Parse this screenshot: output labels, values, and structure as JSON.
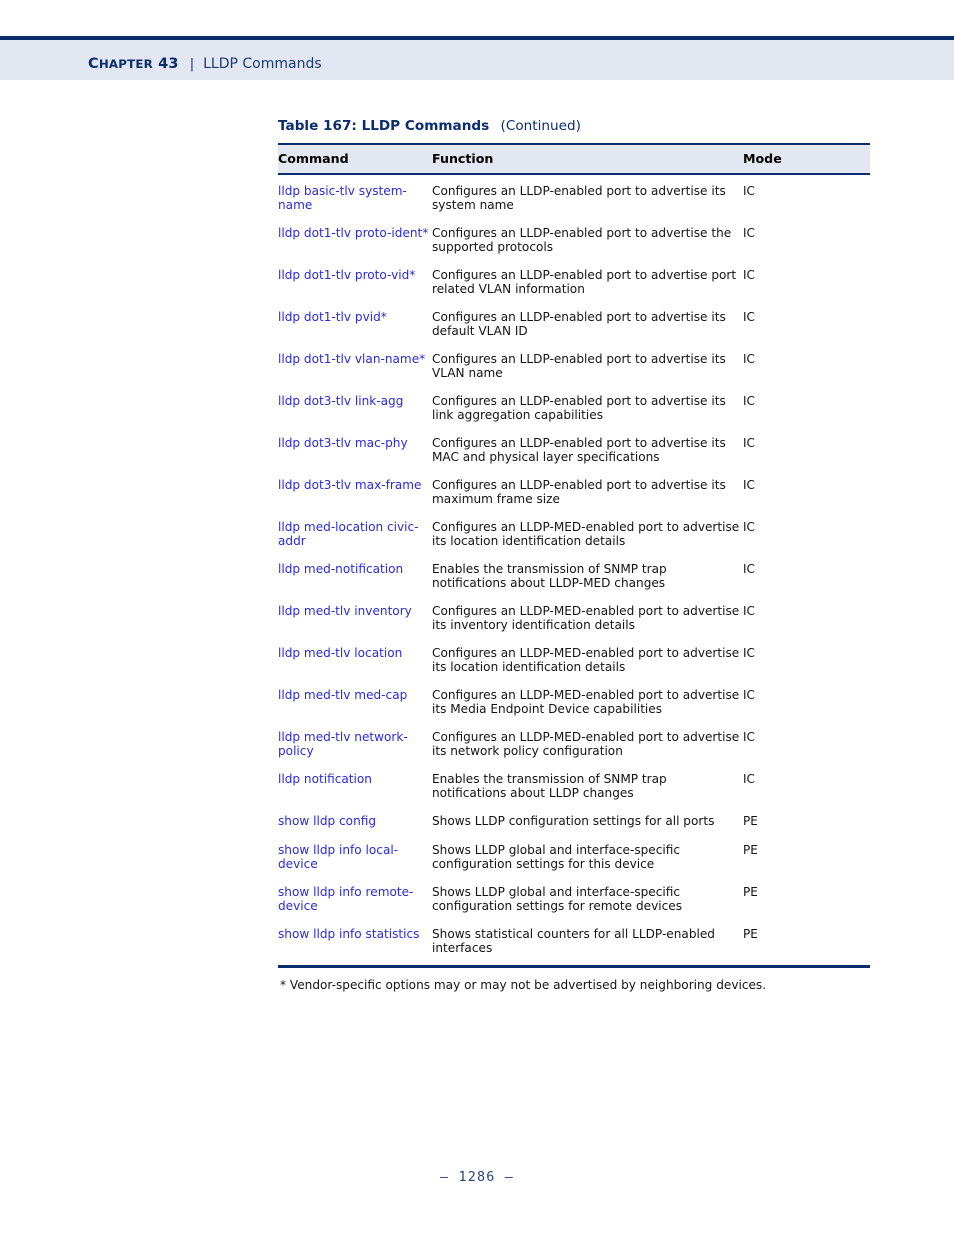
{
  "colors": {
    "navy": "#0a2d6e",
    "header_band_bg": "#e3e7f1",
    "link_blue": "#2a2ade",
    "body_text": "#141414",
    "footer_text": "#2a4478"
  },
  "header": {
    "chapter_prefix": "C",
    "chapter_word_rest": "HAPTER",
    "chapter_label": "Chapter 43",
    "chapter_number": "43",
    "separator": "|",
    "topic": "LLDP Commands"
  },
  "table": {
    "caption_main": "Table 167: LLDP Commands",
    "caption_continued": "(Continued)",
    "columns": [
      "Command",
      "Function",
      "Mode"
    ],
    "rows": [
      {
        "command": "lldp basic-tlv system-name",
        "function": "Configures an LLDP-enabled port to advertise its system name",
        "mode": "IC"
      },
      {
        "command": "lldp dot1-tlv proto-ident*",
        "function": "Configures an LLDP-enabled port to advertise the supported protocols",
        "mode": "IC"
      },
      {
        "command": "lldp dot1-tlv proto-vid*",
        "function": "Configures an LLDP-enabled port to advertise port related VLAN information",
        "mode": "IC"
      },
      {
        "command": "lldp dot1-tlv pvid*",
        "function": "Configures an LLDP-enabled port to advertise its default VLAN ID",
        "mode": "IC"
      },
      {
        "command": "lldp dot1-tlv vlan-name*",
        "function": "Configures an LLDP-enabled port to advertise its VLAN name",
        "mode": "IC"
      },
      {
        "command": "lldp dot3-tlv link-agg",
        "function": "Configures an LLDP-enabled port to advertise its link aggregation capabilities",
        "mode": "IC"
      },
      {
        "command": "lldp dot3-tlv mac-phy",
        "function": "Configures an LLDP-enabled port to advertise its MAC and physical layer specifications",
        "mode": "IC"
      },
      {
        "command": "lldp dot3-tlv max-frame",
        "function": "Configures an LLDP-enabled port to advertise its maximum frame size",
        "mode": "IC"
      },
      {
        "command": "lldp med-location civic-addr",
        "function": "Configures an LLDP-MED-enabled port to advertise its location identification details",
        "mode": "IC"
      },
      {
        "command": "lldp med-notification",
        "function": "Enables the transmission of SNMP trap notifications about LLDP-MED changes",
        "mode": "IC"
      },
      {
        "command": "lldp med-tlv inventory",
        "function": "Configures an LLDP-MED-enabled port to advertise its inventory identification details",
        "mode": "IC"
      },
      {
        "command": "lldp med-tlv location",
        "function": "Configures an LLDP-MED-enabled port to advertise its location identification details",
        "mode": "IC"
      },
      {
        "command": "lldp med-tlv med-cap",
        "function": "Configures an LLDP-MED-enabled port to advertise its Media Endpoint Device capabilities",
        "mode": "IC"
      },
      {
        "command": "lldp med-tlv network-policy",
        "function": "Configures an LLDP-MED-enabled port to advertise its network policy configuration",
        "mode": "IC"
      },
      {
        "command": "lldp notification",
        "function": "Enables the transmission of SNMP trap notifications about LLDP changes",
        "mode": "IC"
      },
      {
        "command": "show lldp config",
        "function": "Shows LLDP configuration settings for all ports",
        "mode": "PE"
      },
      {
        "command": "show lldp info local-device",
        "function": "Shows LLDP global and interface-specific configuration settings for this device",
        "mode": "PE"
      },
      {
        "command": "show lldp info remote-device",
        "function": "Shows LLDP global and interface-specific configuration settings for remote devices",
        "mode": "PE"
      },
      {
        "command": "show lldp info statistics",
        "function": "Shows statistical counters for all LLDP-enabled interfaces",
        "mode": "PE"
      }
    ],
    "footnote": "*  Vendor-specific options may or may not be advertised by neighboring devices."
  },
  "footer": {
    "page_number": "–  1286  –"
  }
}
